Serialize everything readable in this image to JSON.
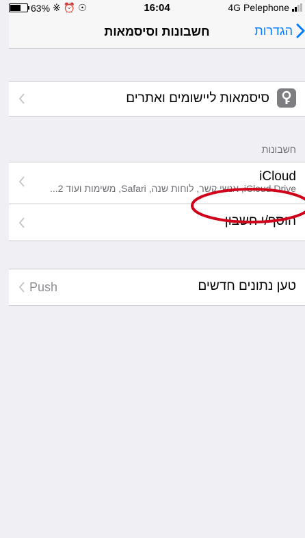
{
  "status_bar": {
    "battery": "63%",
    "time": "16:04",
    "network": "4G",
    "carrier": "Pelephone"
  },
  "nav": {
    "title": "חשבונות וסיסמאות",
    "back_label": "הגדרות"
  },
  "passwords": {
    "label": "סיסמאות ליישומים ואתרים",
    "icon": "key-icon"
  },
  "accounts": {
    "header": "חשבונות",
    "icloud": {
      "title": "iCloud",
      "subtitle": "iCloud Drive, אנשי קשר, לוחות שנה, Safari, משימות ועוד 2..."
    },
    "add_account": "הוסף/י חשבון"
  },
  "fetch": {
    "label": "טען נתונים חדשים",
    "value": "Push"
  },
  "colors": {
    "accent": "#007aff",
    "annotation": "#d0021b"
  }
}
